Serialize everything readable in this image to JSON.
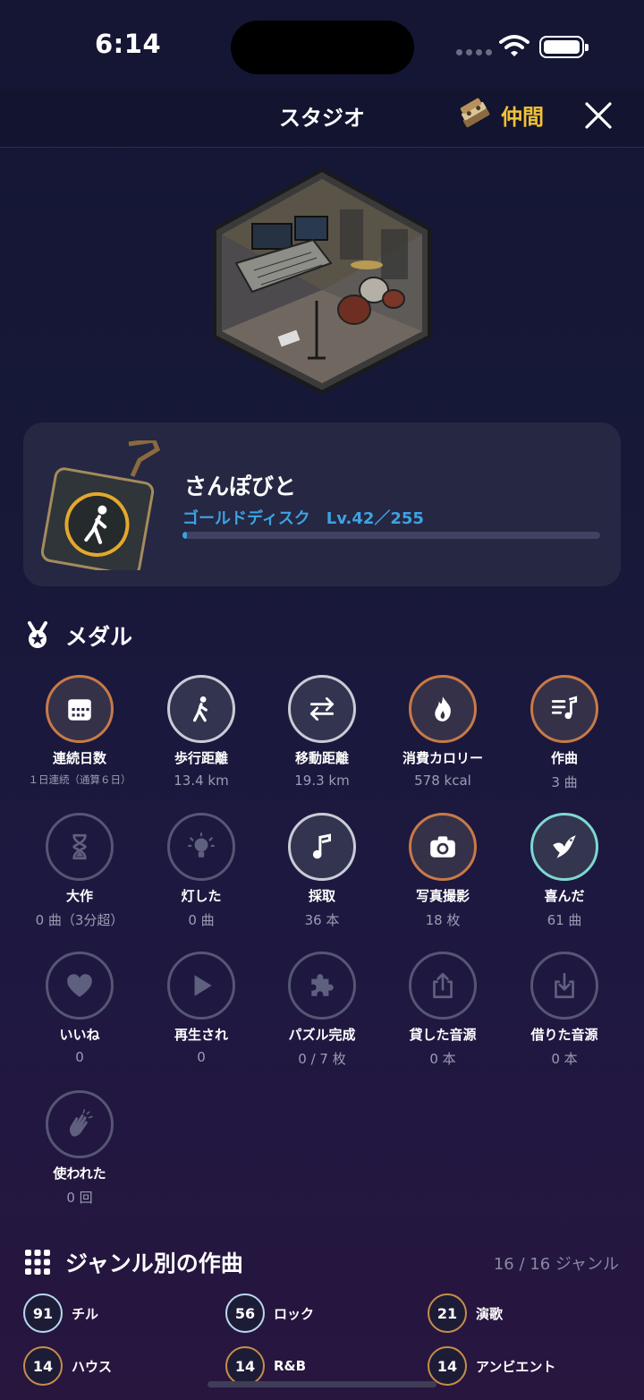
{
  "status": {
    "time": "6:14"
  },
  "nav": {
    "title": "スタジオ",
    "friends_label": "仲間"
  },
  "profile": {
    "title": "さんぽびと",
    "rank": "ゴールドディスク",
    "level": "Lv.42／255",
    "progress_percent": 1
  },
  "medals": {
    "title": "メダル",
    "items": [
      {
        "label": "連続日数",
        "value": "１日連続（通算６日）",
        "tier": "bronze",
        "icon": "calendar-icon"
      },
      {
        "label": "歩行距離",
        "value": "13.4 km",
        "tier": "silver",
        "icon": "walk-icon"
      },
      {
        "label": "移動距離",
        "value": "19.3 km",
        "tier": "silver",
        "icon": "arrows-icon"
      },
      {
        "label": "消費カロリー",
        "value": "578 kcal",
        "tier": "bronze",
        "icon": "flame-icon"
      },
      {
        "label": "作曲",
        "value": "3 曲",
        "tier": "bronze",
        "icon": "music-list-icon"
      },
      {
        "label": "大作",
        "value": "0 曲（3分超）",
        "tier": "dim",
        "icon": "hourglass-icon"
      },
      {
        "label": "灯した",
        "value": "0 曲",
        "tier": "dim",
        "icon": "bulb-icon"
      },
      {
        "label": "採取",
        "value": "36 本",
        "tier": "silver",
        "icon": "note-icon"
      },
      {
        "label": "写真撮影",
        "value": "18 枚",
        "tier": "bronze",
        "icon": "camera-icon"
      },
      {
        "label": "喜んだ",
        "value": "61 曲",
        "tier": "teal",
        "icon": "bird-icon"
      },
      {
        "label": "いいね",
        "value": "0",
        "tier": "dim",
        "icon": "heart-icon"
      },
      {
        "label": "再生され",
        "value": "0",
        "tier": "dim",
        "icon": "play-icon"
      },
      {
        "label": "パズル完成",
        "value": "0 / 7 枚",
        "tier": "dim",
        "icon": "puzzle-icon"
      },
      {
        "label": "貸した音源",
        "value": "0 本",
        "tier": "dim",
        "icon": "share-out-icon"
      },
      {
        "label": "借りた音源",
        "value": "0 本",
        "tier": "dim",
        "icon": "share-in-icon"
      },
      {
        "label": "使われた",
        "value": "0 回",
        "tier": "dim",
        "icon": "clap-icon"
      }
    ]
  },
  "genres": {
    "title": "ジャンル別の作曲",
    "count": "16 / 16 ジャンル",
    "items": [
      {
        "count": "91",
        "name": "チル",
        "style": "cool"
      },
      {
        "count": "56",
        "name": "ロック",
        "style": "cool"
      },
      {
        "count": "21",
        "name": "演歌",
        "style": "warm"
      },
      {
        "count": "14",
        "name": "ハウス",
        "style": "warm"
      },
      {
        "count": "14",
        "name": "R&B",
        "style": "warm"
      },
      {
        "count": "14",
        "name": "アンビエント",
        "style": "warm"
      }
    ]
  },
  "colors": {
    "accent_blue": "#3da3e3",
    "gold": "#f2c234",
    "bronze": "#c87a46",
    "silver": "#c9cbd6",
    "teal": "#7dd8cf"
  }
}
